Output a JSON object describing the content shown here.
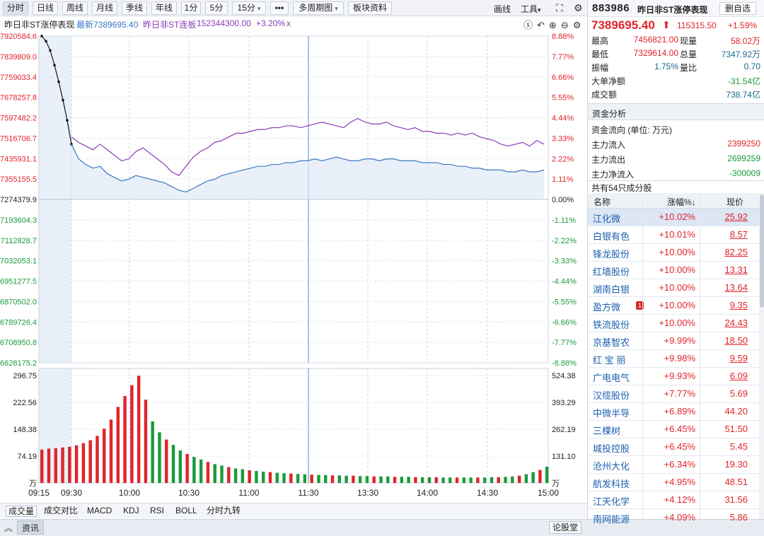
{
  "toolbar": {
    "periods": [
      "分时",
      "日线",
      "周线",
      "月线",
      "季线",
      "年线",
      "1分",
      "5分",
      "15分",
      "•••",
      "多周期图",
      "板块资料"
    ],
    "draw_label": "画线",
    "tools_label": "工具",
    "fullscreen_icon": "expand-icon",
    "settings_icon": "gear-icon"
  },
  "infoline": {
    "name": "昨日非ST涨停表现",
    "latest_label": "最新7389695.40",
    "compare_name": "昨日非ST连板",
    "compare_value": "152344300.00",
    "compare_pct": "+3.20%",
    "close_x": "x"
  },
  "chart_data": {
    "type": "line",
    "time_ticks": [
      "09:15",
      "09:30",
      "10:00",
      "10:30",
      "11:00",
      "11:30",
      "13:30",
      "14:00",
      "14:30",
      "15:00"
    ],
    "price_ticks_left": [
      "7920584.6",
      "7839809.0",
      "7759033.4",
      "7678257.8",
      "7597482.2",
      "7516706.7",
      "7435931.1",
      "7355155.5",
      "7274379.9",
      "7193604.3",
      "7112828.7",
      "7032053.1",
      "6951277.5",
      "6870502.0",
      "6789726.4",
      "6708950.8",
      "6628175.2"
    ],
    "pct_ticks_right": [
      "8.88%",
      "7.77%",
      "6.66%",
      "5.55%",
      "4.44%",
      "3.33%",
      "2.22%",
      "1.11%",
      "0.00%",
      "-1.11%",
      "-2.22%",
      "-3.33%",
      "-4.44%",
      "-5.55%",
      "-6.66%",
      "-7.77%",
      "-8.88%"
    ],
    "volume_ticks_left": [
      "296.75",
      "222.56",
      "148.38",
      "74.19",
      "万"
    ],
    "volume_ticks_right": [
      "524.38",
      "393.29",
      "262.19",
      "131.10",
      "万"
    ],
    "ylim_pct": [
      -8.88,
      8.88
    ],
    "grid": true,
    "series": [
      {
        "name": "昨日非ST涨停表现",
        "color": "#3c79c3",
        "values_pct": [
          8.88,
          8.6,
          8.1,
          7.3,
          6.4,
          5.4,
          4.3,
          3.0,
          2.2,
          1.9,
          1.7,
          1.8,
          1.4,
          1.2,
          1.0,
          1.1,
          1.3,
          1.2,
          1.1,
          1.0,
          0.9,
          0.7,
          0.5,
          0.4,
          0.6,
          0.8,
          1.0,
          1.1,
          1.3,
          1.4,
          1.5,
          1.6,
          1.7,
          1.8,
          1.8,
          1.9,
          1.9,
          2.0,
          2.0,
          2.1,
          2.1,
          2.2,
          2.1,
          2.2,
          2.3,
          2.2,
          2.1,
          2.1,
          2.2,
          2.2,
          2.1,
          2.2,
          2.2,
          2.1,
          2.1,
          2.1,
          2.0,
          2.0,
          2.0,
          1.9,
          1.9,
          1.8,
          1.8,
          1.7,
          1.7,
          1.6,
          1.6,
          1.6,
          1.5,
          1.5,
          1.6,
          1.5,
          1.5,
          1.6
        ]
      },
      {
        "name": "昨日非ST连板",
        "color": "#8a3ab9",
        "values_pct": [
          8.88,
          8.6,
          8.1,
          7.3,
          6.4,
          5.4,
          4.3,
          3.4,
          3.1,
          2.9,
          2.7,
          3.0,
          2.7,
          2.4,
          2.1,
          2.2,
          2.6,
          2.8,
          2.5,
          2.2,
          1.9,
          1.5,
          1.3,
          1.8,
          2.3,
          2.6,
          2.8,
          3.1,
          3.2,
          3.4,
          3.6,
          3.6,
          3.7,
          3.8,
          3.8,
          3.9,
          3.9,
          4.0,
          4.0,
          3.9,
          4.0,
          4.1,
          4.2,
          4.1,
          4.0,
          3.9,
          4.2,
          4.4,
          4.2,
          4.1,
          4.1,
          4.2,
          4.0,
          3.9,
          3.8,
          3.9,
          3.7,
          3.7,
          3.6,
          3.6,
          3.5,
          3.6,
          3.5,
          3.6,
          3.4,
          3.3,
          3.2,
          3.0,
          2.9,
          3.0,
          3.1,
          2.9,
          3.2,
          3.0
        ]
      }
    ],
    "volume_values": [
      92,
      95,
      96,
      98,
      100,
      104,
      110,
      118,
      130,
      150,
      175,
      210,
      240,
      270,
      296,
      230,
      170,
      140,
      120,
      105,
      90,
      80,
      72,
      65,
      58,
      52,
      48,
      44,
      40,
      38,
      35,
      33,
      31,
      30,
      28,
      27,
      26,
      25,
      24,
      23,
      22,
      22,
      21,
      21,
      20,
      20,
      19,
      19,
      18,
      18,
      18,
      17,
      17,
      17,
      16,
      16,
      16,
      16,
      15,
      15,
      15,
      15,
      15,
      15,
      15,
      16,
      16,
      17,
      18,
      20,
      24,
      30,
      36,
      45
    ]
  },
  "indicator_tabs": [
    "成交量",
    "成交对比",
    "MACD",
    "KDJ",
    "RSI",
    "BOLL",
    "分时九转"
  ],
  "bottom": {
    "info_label": "资讯",
    "forum_label": "论股堂",
    "collapse_icon": "double-chevron-up-icon"
  },
  "quote": {
    "code": "883986",
    "name": "昨日非ST涨停表现",
    "delete_label": "删自选",
    "price": "7389695.40",
    "change": "115315.50",
    "change_pct": "+1.59%",
    "stats": [
      {
        "k1": "最高",
        "v1": "7456821.00",
        "k2": "现量",
        "v2": "58.02万"
      },
      {
        "k1": "最低",
        "v1": "7329614.00",
        "k2": "总量",
        "v2": "7347.92万"
      },
      {
        "k1": "振幅",
        "v1": "1.75%",
        "k2": "量比",
        "v2": "0.70"
      }
    ],
    "big_order_label": "大单净额",
    "big_order_value": "-31.54亿",
    "turnover_label": "成交额",
    "turnover_value": "738.74亿"
  },
  "fund": {
    "section_title": "资金分析",
    "unit_label": "资金流向 (单位: 万元)",
    "rows": [
      {
        "label": "主力流入",
        "value": "2399250",
        "color": "#e0242b"
      },
      {
        "label": "主力流出",
        "value": "2699259",
        "color": "#1a9b3c"
      },
      {
        "label": "主力净流入",
        "value": "-300009",
        "color": "#1a9b3c"
      }
    ]
  },
  "constituents": {
    "title": "共有54只成分股",
    "headers": [
      "名称",
      "涨幅%↓",
      "现价"
    ],
    "rows": [
      {
        "name": "江化微",
        "chg": "+10.02%",
        "price": "25.92",
        "underline": true,
        "badge": ""
      },
      {
        "name": "白银有色",
        "chg": "+10.01%",
        "price": "8.57",
        "underline": true,
        "badge": ""
      },
      {
        "name": "锋龙股份",
        "chg": "+10.00%",
        "price": "82.25",
        "underline": true,
        "badge": ""
      },
      {
        "name": "红墙股份",
        "chg": "+10.00%",
        "price": "13.31",
        "underline": true,
        "badge": ""
      },
      {
        "name": "湖南白银",
        "chg": "+10.00%",
        "price": "13.64",
        "underline": true,
        "badge": ""
      },
      {
        "name": "盈方微",
        "chg": "+10.00%",
        "price": "9.35",
        "underline": true,
        "badge": "1"
      },
      {
        "name": "铁流股份",
        "chg": "+10.00%",
        "price": "24.43",
        "underline": true,
        "badge": ""
      },
      {
        "name": "京基智农",
        "chg": "+9.99%",
        "price": "18.50",
        "underline": true,
        "badge": ""
      },
      {
        "name": "红 宝 丽",
        "chg": "+9.98%",
        "price": "9.59",
        "underline": true,
        "badge": ""
      },
      {
        "name": "广电电气",
        "chg": "+9.93%",
        "price": "6.09",
        "underline": true,
        "badge": ""
      },
      {
        "name": "汉缆股份",
        "chg": "+7.77%",
        "price": "5.69",
        "underline": false,
        "badge": ""
      },
      {
        "name": "中微半导",
        "chg": "+6.89%",
        "price": "44.20",
        "underline": false,
        "badge": ""
      },
      {
        "name": "三棵树",
        "chg": "+6.45%",
        "price": "51.50",
        "underline": false,
        "badge": ""
      },
      {
        "name": "城投控股",
        "chg": "+6.45%",
        "price": "5.45",
        "underline": false,
        "badge": ""
      },
      {
        "name": "沧州大化",
        "chg": "+6.34%",
        "price": "19.30",
        "underline": false,
        "badge": ""
      },
      {
        "name": "航发科技",
        "chg": "+4.95%",
        "price": "48.51",
        "underline": false,
        "badge": ""
      },
      {
        "name": "江天化学",
        "chg": "+4.12%",
        "price": "31.56",
        "underline": false,
        "badge": ""
      },
      {
        "name": "南网能源",
        "chg": "+4.09%",
        "price": "5.86",
        "underline": false,
        "badge": ""
      }
    ]
  }
}
